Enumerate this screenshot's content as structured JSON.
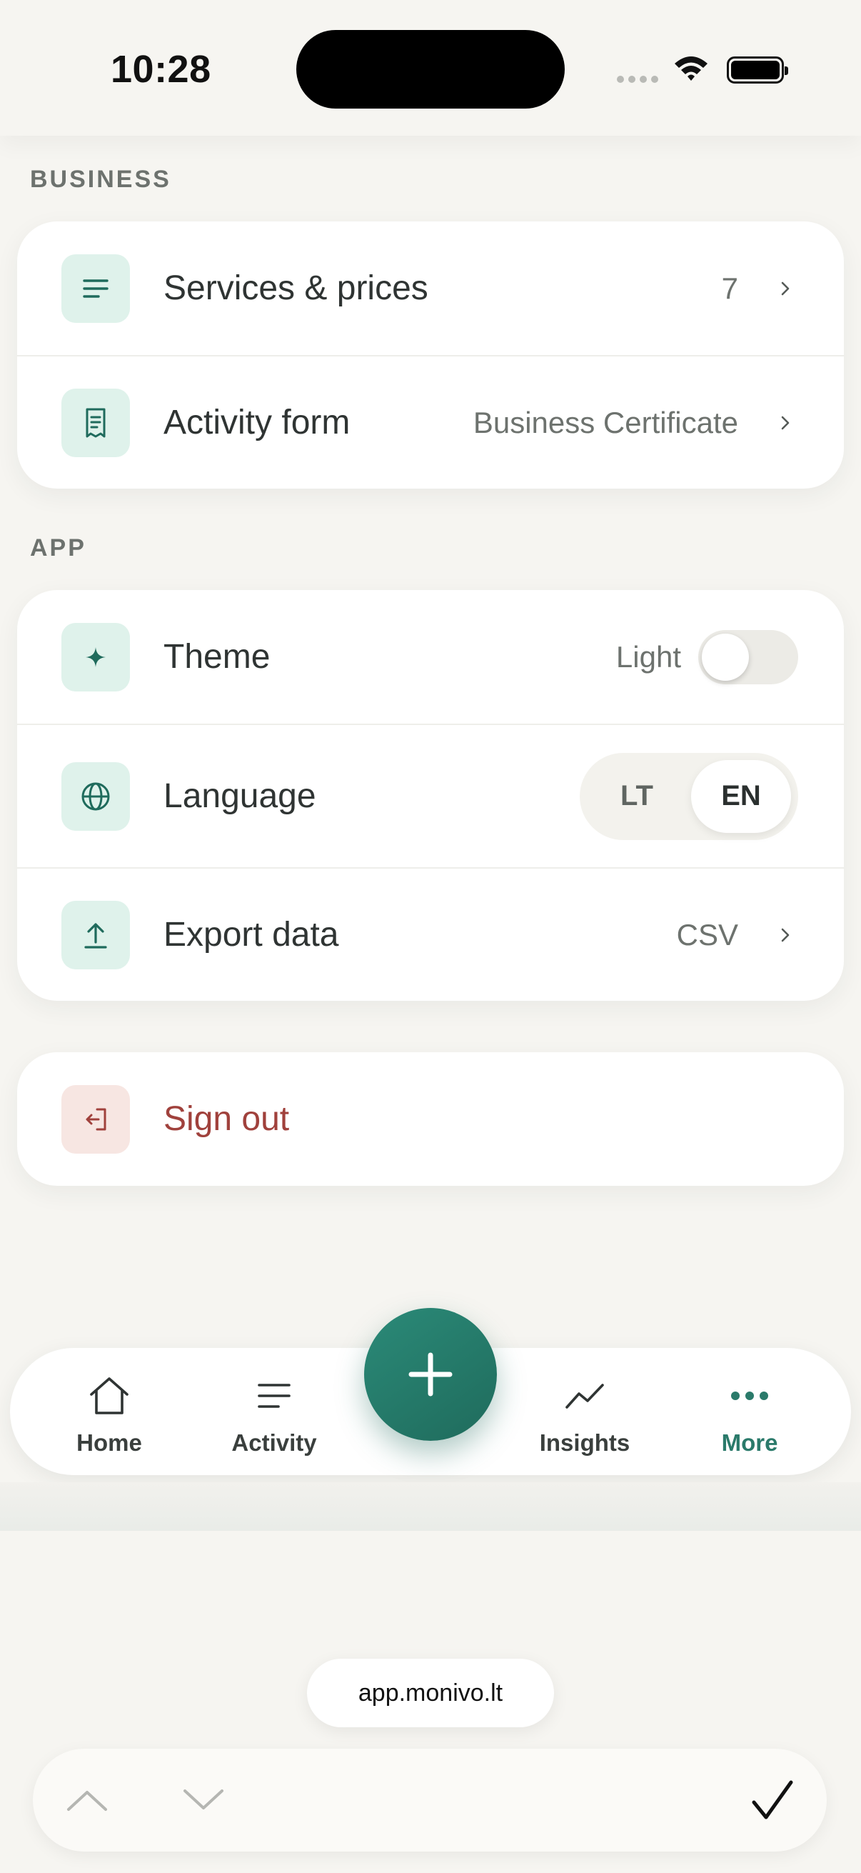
{
  "status": {
    "time": "10:28"
  },
  "sections": {
    "business": "BUSINESS",
    "app": "APP"
  },
  "business": [
    {
      "icon": "list-icon",
      "label": "Services & prices",
      "value": "7"
    },
    {
      "icon": "receipt-icon",
      "label": "Activity form",
      "value": "Business Certificate"
    }
  ],
  "app": {
    "theme": {
      "icon": "sparkle-icon",
      "label": "Theme",
      "value": "Light",
      "toggle_on": false
    },
    "language": {
      "icon": "globe-icon",
      "label": "Language",
      "options": [
        "LT",
        "EN"
      ],
      "selected": "EN"
    },
    "export": {
      "icon": "upload-icon",
      "label": "Export data",
      "value": "CSV"
    }
  },
  "signout": {
    "icon": "logout-icon",
    "label": "Sign out"
  },
  "tabs": [
    {
      "label": "Home",
      "icon": "home-icon"
    },
    {
      "label": "Activity",
      "icon": "list-icon"
    },
    {
      "label": "Insights",
      "icon": "trend-icon"
    },
    {
      "label": "More",
      "icon": "more-icon",
      "active": true
    }
  ],
  "fab": {
    "icon": "plus-icon"
  },
  "browser": {
    "url": "app.monivo.lt"
  },
  "colors": {
    "accent": "#2a7a6a",
    "tile": "#dff2eb",
    "danger": "#a0413c",
    "background": "#f6f5f1"
  }
}
